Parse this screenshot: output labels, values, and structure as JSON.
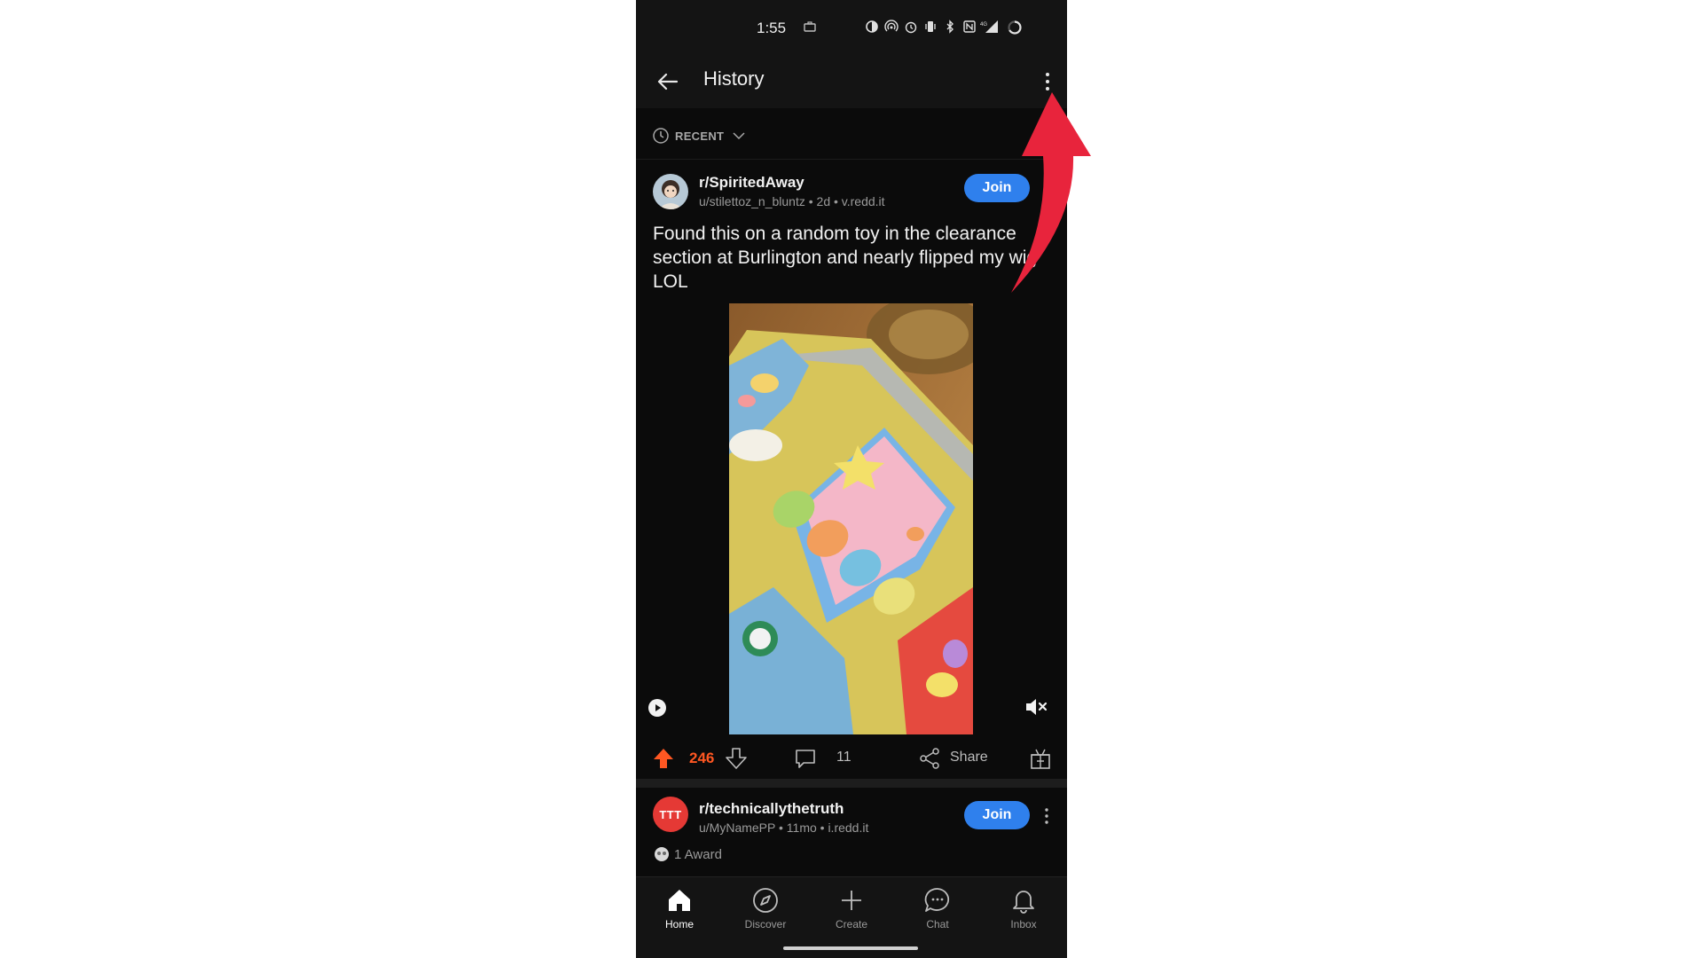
{
  "status_bar": {
    "time": "1:55",
    "icons": [
      "briefcase-icon",
      "data-saver-icon",
      "hotspot-icon",
      "alarm-icon",
      "vibrate-icon",
      "bluetooth-icon",
      "nfc-icon",
      "signal-4g-icon",
      "battery-ring-icon"
    ]
  },
  "app_bar": {
    "title": "History",
    "back_icon": "arrow-left-icon",
    "overflow_icon": "more-vertical-icon"
  },
  "sort": {
    "label": "RECENT",
    "icon": "clock-icon"
  },
  "posts": [
    {
      "subreddit": "r/SpiritedAway",
      "meta": "u/stilettoz_n_bluntz • 2d • v.redd.it",
      "join_label": "Join",
      "title": "Found this on a random toy in the clearance section at Burlington and nearly flipped my wig LOL",
      "votes": "246",
      "comments": "11",
      "share_label": "Share"
    },
    {
      "subreddit": "r/technicallythetruth",
      "avatar_text": "TTT",
      "meta": "u/MyNamePP • 11mo • i.redd.it",
      "join_label": "Join",
      "award_text": "1 Award"
    }
  ],
  "bottom_nav": [
    {
      "label": "Home",
      "icon": "home-icon",
      "active": true
    },
    {
      "label": "Discover",
      "icon": "compass-icon",
      "active": false
    },
    {
      "label": "Create",
      "icon": "plus-icon",
      "active": false
    },
    {
      "label": "Chat",
      "icon": "chat-bubble-icon",
      "active": false
    },
    {
      "label": "Inbox",
      "icon": "bell-icon",
      "active": false
    }
  ],
  "colors": {
    "background": "#0b0b0b",
    "upvote_active": "#ff5722",
    "join_button": "#2f80ed",
    "annotation_arrow": "#e8243c"
  }
}
